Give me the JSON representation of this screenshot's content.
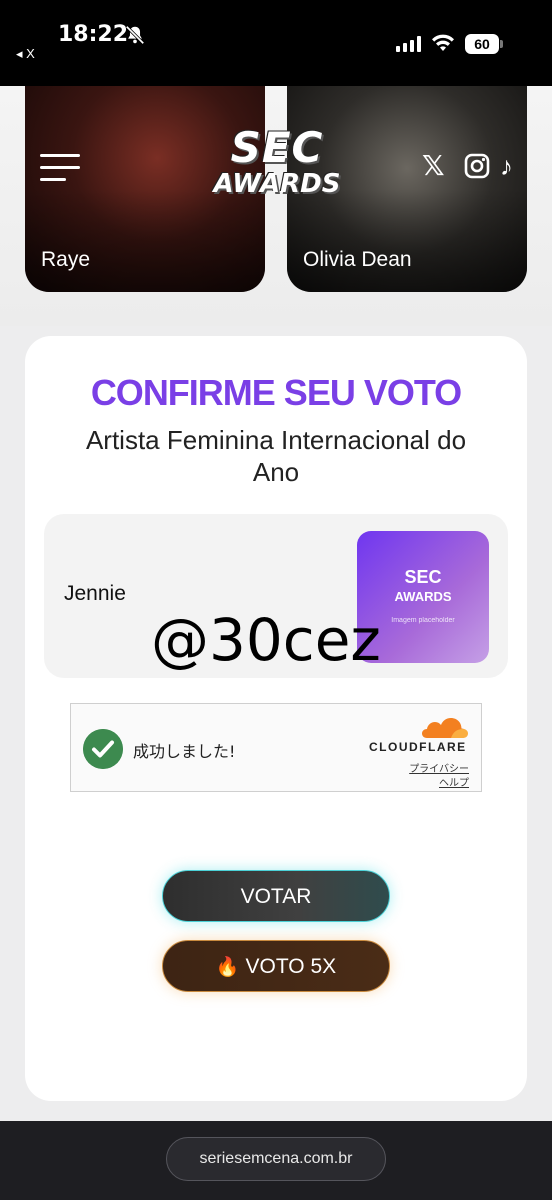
{
  "status_bar": {
    "time": "18:22",
    "back_app": "◂ X",
    "battery": "60"
  },
  "header": {
    "logo_top": "SEC",
    "logo_bottom": "AWARDS",
    "social": {
      "x": "𝕏",
      "tiktok": "♪"
    }
  },
  "artists": [
    {
      "name": "Raye"
    },
    {
      "name": "Olivia Dean"
    }
  ],
  "vote": {
    "title": "CONFIRME SEU VOTO",
    "category": "Artista Feminina Internacional do Ano",
    "candidate": "Jennie",
    "image_sec": "SEC",
    "image_awards": "AWARDS",
    "image_placeholder": "Imagem placeholder",
    "watermark": "@30cez"
  },
  "captcha": {
    "status_text": "成功しました!",
    "brand": "CLOUDFLARE",
    "privacy": "プライバシー",
    "help": "ヘルプ"
  },
  "buttons": {
    "vote": "VOTAR",
    "vote5_icon": "🔥",
    "vote5": "VOTO 5X"
  },
  "browser": {
    "url": "seriesemcena.com.br"
  },
  "colors": {
    "accent": "#7a3fe6",
    "success": "#3d8a4f",
    "cloudflare": "#f38020"
  }
}
